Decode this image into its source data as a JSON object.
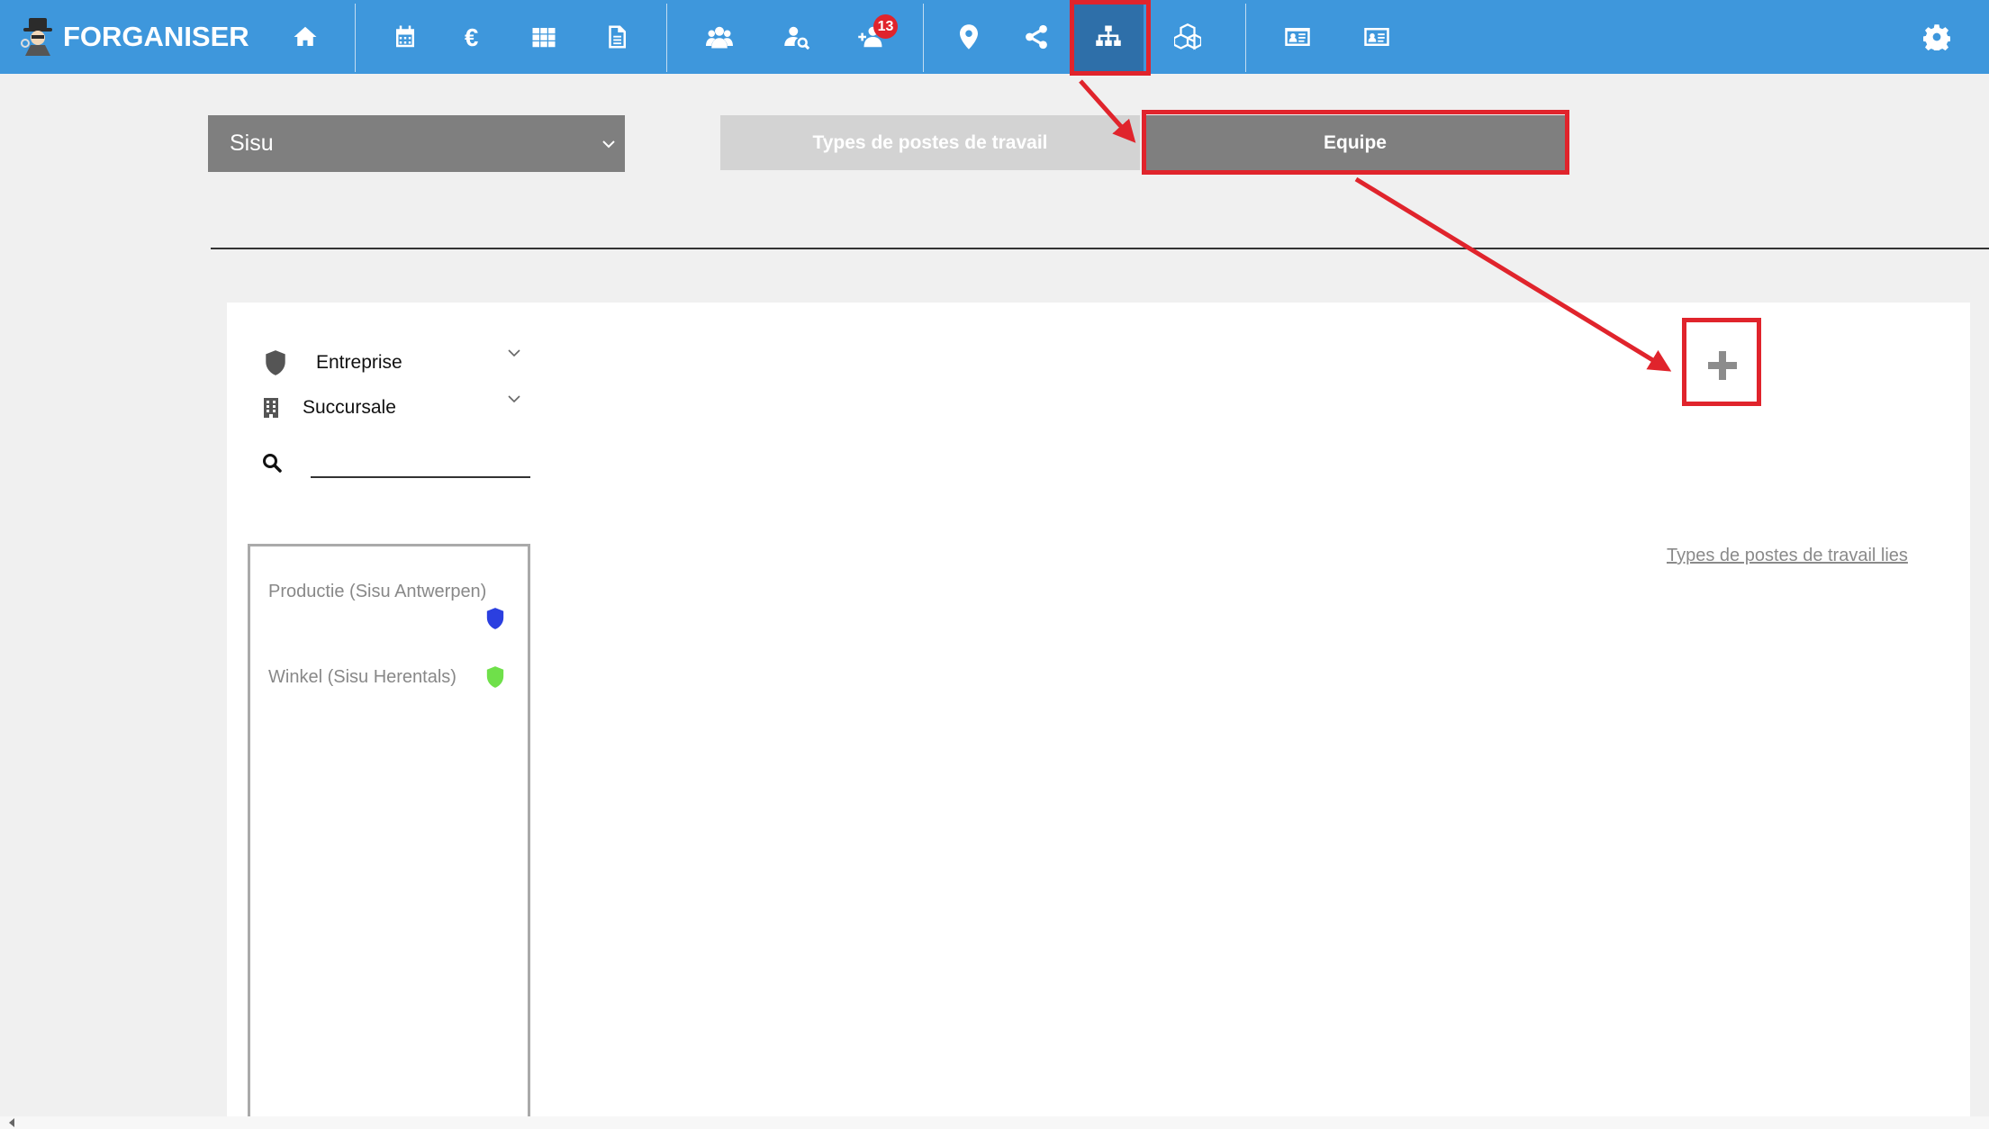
{
  "app": {
    "name": "FORGANISER"
  },
  "nav": {
    "notification_count": "13",
    "items": [
      {
        "icon": "home-icon"
      },
      {
        "icon": "calendar-icon"
      },
      {
        "icon": "euro-icon"
      },
      {
        "icon": "grid-icon"
      },
      {
        "icon": "document-icon"
      },
      {
        "icon": "users-icon"
      },
      {
        "icon": "user-search-icon"
      },
      {
        "icon": "add-user-icon"
      },
      {
        "icon": "map-pin-icon"
      },
      {
        "icon": "share-icon"
      },
      {
        "icon": "org-chart-icon",
        "active": true
      },
      {
        "icon": "cubes-icon"
      },
      {
        "icon": "id-card-icon"
      },
      {
        "icon": "id-card-alt-icon"
      },
      {
        "icon": "gear-icon"
      }
    ]
  },
  "company_select": {
    "value": "Sisu"
  },
  "tabs": {
    "types_label": "Types de postes de travail",
    "equipe_label": "Equipe",
    "active": "Equipe"
  },
  "filters": {
    "entreprise_label": "Entreprise",
    "succursale_label": "Succursale",
    "search_value": ""
  },
  "teams": [
    {
      "label": "Productie (Sisu Antwerpen)",
      "color": "#2b3fe0"
    },
    {
      "label": "Winkel (Sisu Herentals)",
      "color": "#6fe04a"
    }
  ],
  "linked_types_label": "Types de postes de travail lies",
  "colors": {
    "nav_bg": "#3e97dc",
    "nav_active": "#2e6fa9",
    "annotation": "#e0242c",
    "tab_active": "#7f7f7f",
    "tab_inactive": "#d3d3d3"
  }
}
